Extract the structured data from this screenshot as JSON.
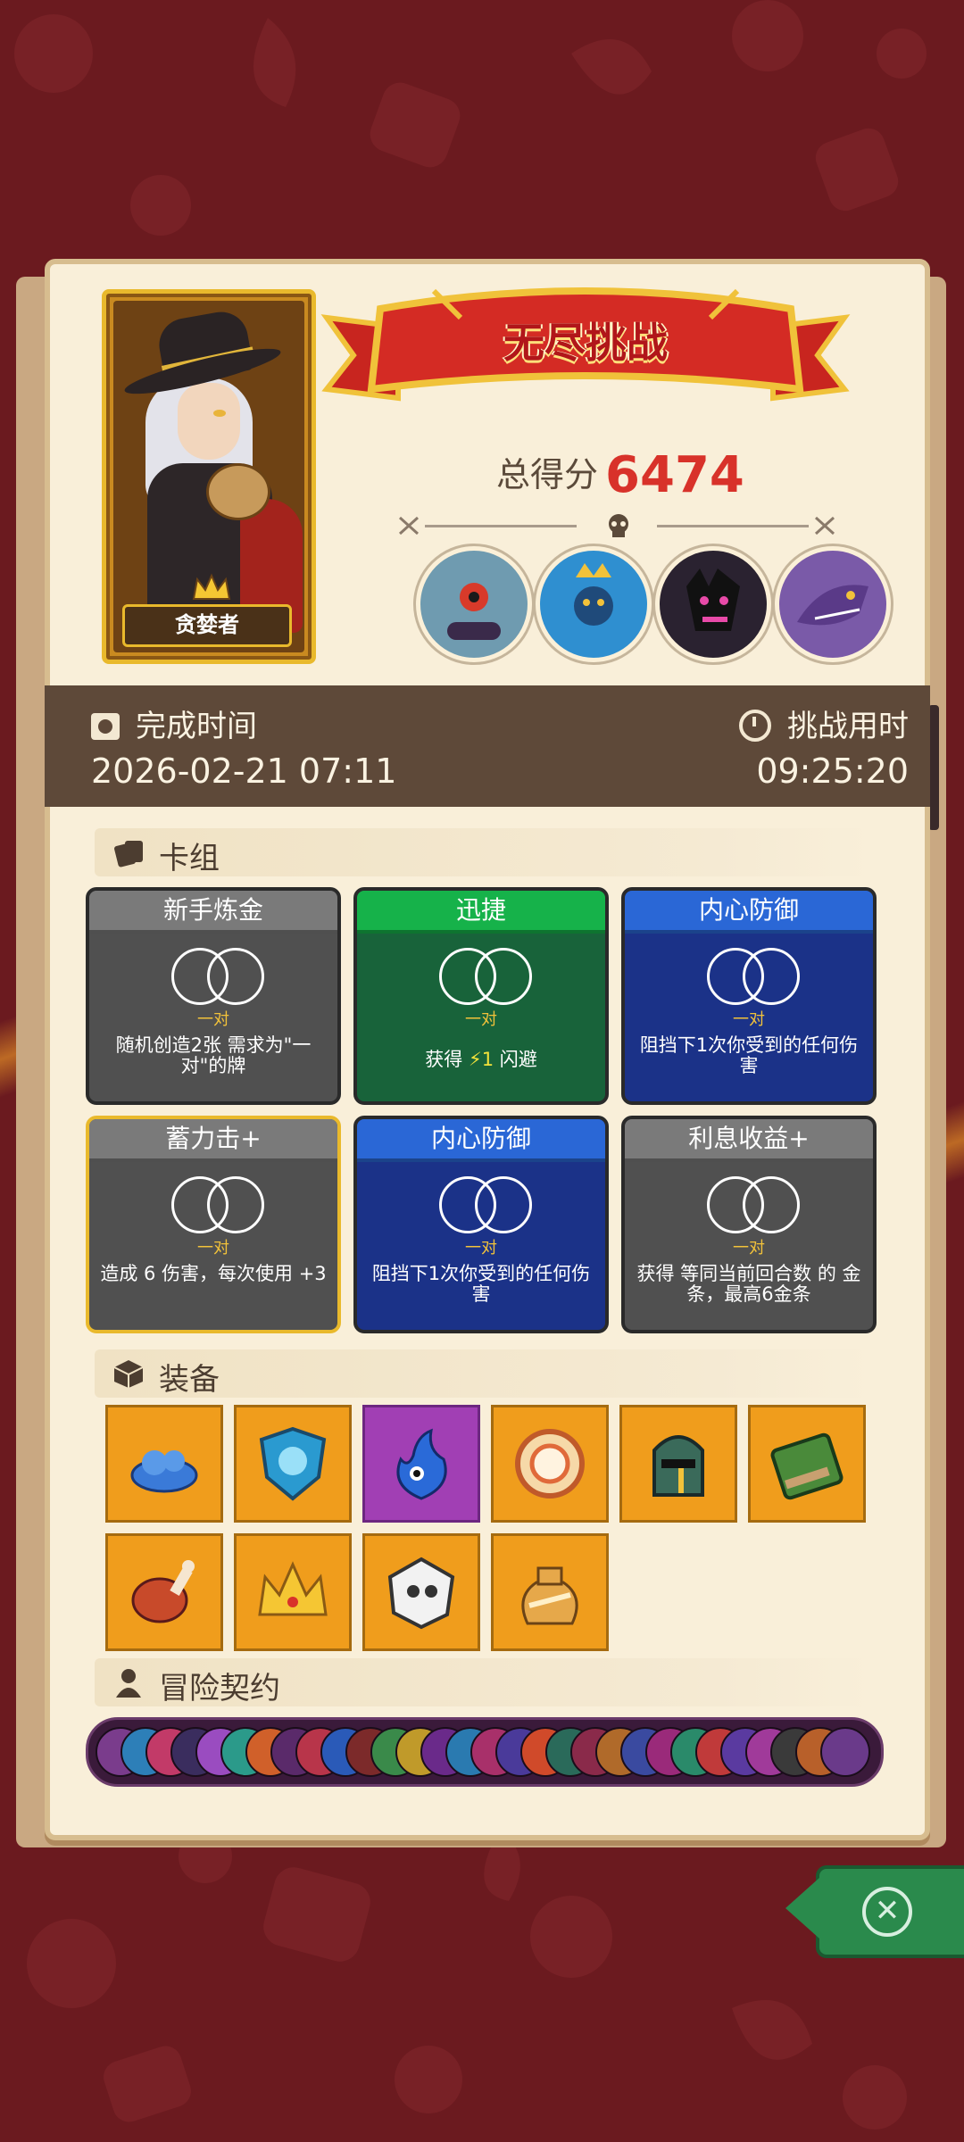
{
  "hero": {
    "name": "贪婪者"
  },
  "header": {
    "banner_title": "无尽挑战",
    "score_label": "总得分",
    "score_value": "6474"
  },
  "times": {
    "finish_label": "完成时间",
    "finish_value": "2026-02-21 07:11",
    "duration_label": "挑战用时",
    "duration_value": "09:25:20"
  },
  "bosses": [
    {
      "name": "blue-cyclops-boss-icon",
      "color": "#6f9bb0"
    },
    {
      "name": "crowned-spider-boss-icon",
      "color": "#2f8fd0"
    },
    {
      "name": "shadow-demon-boss-icon",
      "color": "#2a2230"
    },
    {
      "name": "purple-dragon-boss-icon",
      "color": "#7a5aa8"
    }
  ],
  "deck": {
    "title": "卡组",
    "cards": [
      {
        "title": "新手炼金",
        "pair": "一对",
        "desc": "随机创造2张 需求为\"一对\"的牌",
        "color": "gray"
      },
      {
        "title": "迅捷",
        "pair": "一对",
        "desc_pre": "获得",
        "desc_num": "1",
        "desc_post": "闪避",
        "color": "green"
      },
      {
        "title": "内心防御",
        "pair": "一对",
        "desc": "阻挡下1次你受到的任何伤害",
        "color": "blue"
      },
      {
        "title": "蓄力击+",
        "pair": "一对",
        "desc": "造成 6 伤害，每次使用 +3",
        "color": "gray"
      },
      {
        "title": "内心防御",
        "pair": "一对",
        "desc": "阻挡下1次你受到的任何伤害",
        "color": "blue"
      },
      {
        "title": "利息收益+",
        "pair": "一对",
        "desc": "获得 等同当前回合数 的 金条，最高6金条",
        "color": "gray"
      }
    ]
  },
  "equipment": {
    "title": "装备",
    "items": [
      {
        "name": "blue-slime-icon",
        "rarity": "orange"
      },
      {
        "name": "ice-shield-icon",
        "rarity": "orange"
      },
      {
        "name": "blue-flame-spirit-icon",
        "rarity": "purple"
      },
      {
        "name": "gold-coin-medal-icon",
        "rarity": "orange"
      },
      {
        "name": "knight-helmet-icon",
        "rarity": "orange"
      },
      {
        "name": "moss-book-icon",
        "rarity": "orange"
      },
      {
        "name": "roast-meat-icon",
        "rarity": "orange"
      },
      {
        "name": "gold-crown-icon",
        "rarity": "orange"
      },
      {
        "name": "skull-dice-icon",
        "rarity": "orange"
      },
      {
        "name": "treasure-sack-icon",
        "rarity": "orange"
      }
    ]
  },
  "contract": {
    "title": "冒险契约",
    "chip_colors": [
      "#7a3c8c",
      "#2d7fb8",
      "#c23a68",
      "#3a2d5e",
      "#9a4cc0",
      "#2b9a8a",
      "#d0602a",
      "#5a2a6a",
      "#b8354a",
      "#2a5ab8",
      "#7c2a2a",
      "#3a8a4a",
      "#c09a2a",
      "#6a2a8a",
      "#2a7ab0",
      "#a8306a",
      "#4a3a9a",
      "#d04a2a",
      "#2a6a5a",
      "#8a2a4a",
      "#b06a2a",
      "#3a4aa0",
      "#9a2a7a",
      "#2a8a6a",
      "#c03a3a",
      "#5a3aa0",
      "#a03a9a",
      "#3a3a3a",
      "#b8602a",
      "#6a3a8a"
    ]
  }
}
